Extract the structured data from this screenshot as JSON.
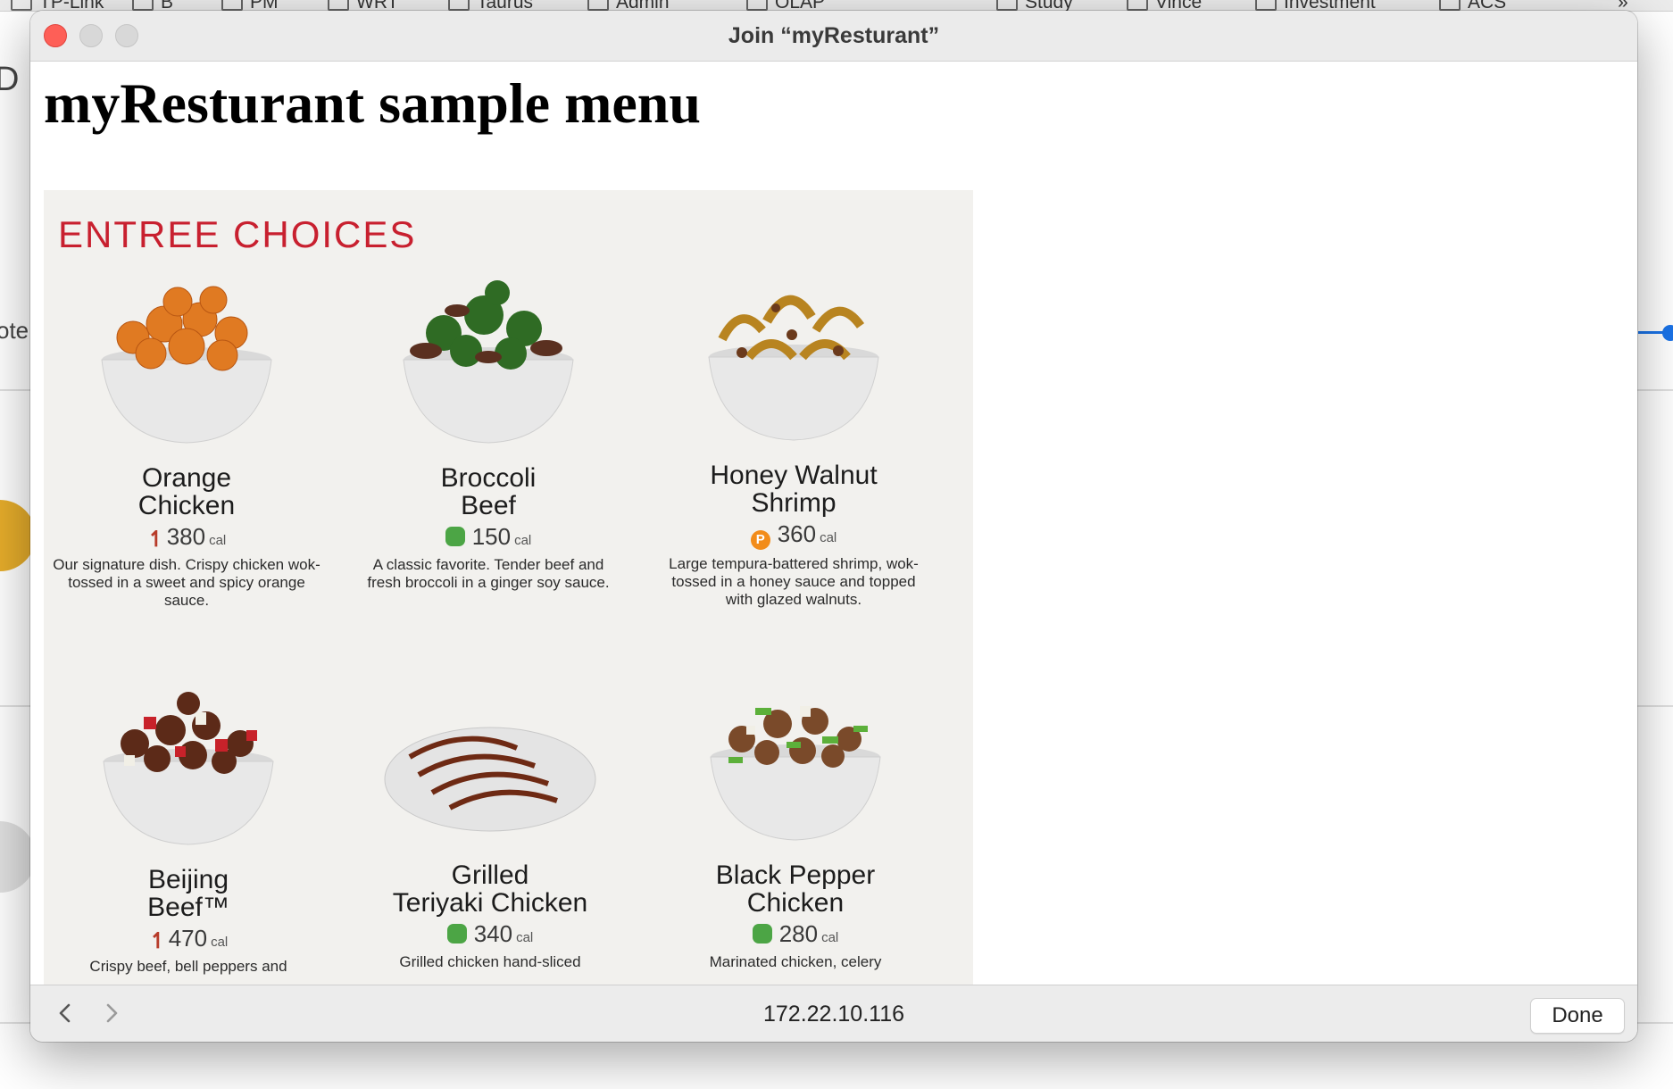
{
  "background": {
    "bookmarks": [
      "TP-Link",
      "B",
      "PM",
      "WRT",
      "Taurus",
      "Admin",
      "OLAP",
      "Study",
      "Vince",
      "Investment",
      "ACS"
    ],
    "overflow": "»",
    "left_letter": "D",
    "left_partial": "ote"
  },
  "window": {
    "title": "Join “myResturant”",
    "controls": [
      "close-icon",
      "minimize-icon",
      "maximize-icon"
    ]
  },
  "page": {
    "heading": "myResturant sample menu"
  },
  "menu": {
    "section_title": "ENTREE CHOICES",
    "cal_unit": "cal",
    "dishes": [
      {
        "name_line1": "Orange",
        "name_line2": "Chicken",
        "calories": "380",
        "icon": "spicy-pepper-icon",
        "desc": "Our signature dish. Crispy chicken wok-tossed in a sweet and spicy orange sauce."
      },
      {
        "name_line1": "Broccoli",
        "name_line2": "Beef",
        "calories": "150",
        "icon": "wok-smart-leaf-icon",
        "desc": "A classic favorite. Tender beef and fresh broccoli in a ginger soy sauce."
      },
      {
        "name_line1": "Honey Walnut",
        "name_line2": "Shrimp",
        "calories": "360",
        "icon": "premium-p-icon",
        "desc": "Large tempura-battered shrimp, wok-tossed in a honey sauce and topped with glazed walnuts."
      },
      {
        "name_line1": "Beijing",
        "name_line2": "Beef™",
        "calories": "470",
        "icon": "spicy-pepper-icon",
        "desc": "Crispy beef, bell peppers and"
      },
      {
        "name_line1": "Grilled",
        "name_line2": "Teriyaki Chicken",
        "calories": "340",
        "icon": "wok-smart-leaf-icon",
        "desc": "Grilled chicken hand-sliced"
      },
      {
        "name_line1": "Black Pepper",
        "name_line2": "Chicken",
        "calories": "280",
        "icon": "wok-smart-leaf-icon",
        "desc": "Marinated chicken, celery"
      }
    ]
  },
  "bottom_bar": {
    "back_icon": "chevron-left-icon",
    "forward_icon": "chevron-right-icon",
    "url": "172.22.10.116",
    "done_label": "Done"
  },
  "colors": {
    "close_red": "#fe5f57",
    "heading_red": "#c8202f",
    "leaf_green": "#4ca545",
    "premium_orange": "#f28c1a",
    "accent_blue": "#1a73e8"
  }
}
